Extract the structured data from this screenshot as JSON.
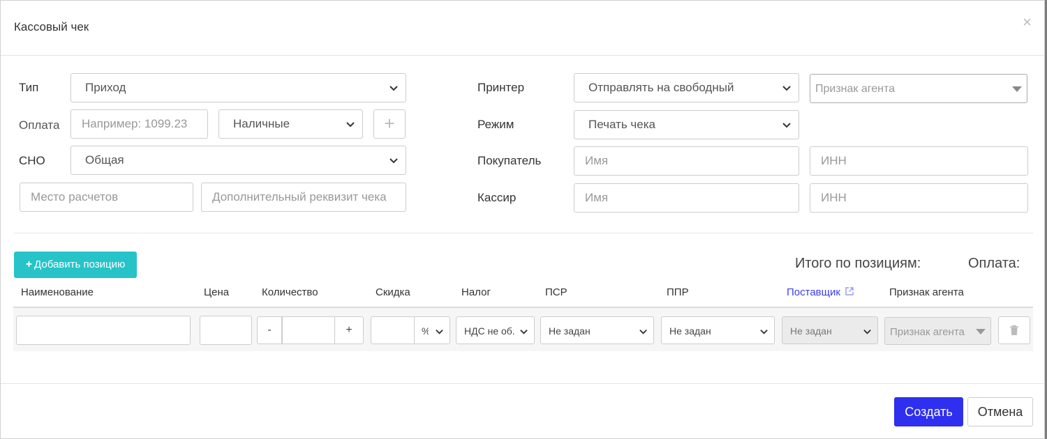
{
  "dialog": {
    "title": "Кассовый чек",
    "close_glyph": "×"
  },
  "form": {
    "type_label": "Тип",
    "type_value": "Приход",
    "payment_label": "Оплата",
    "payment_amount_placeholder": "Например: 1099.23",
    "payment_method_value": "Наличные",
    "payment_add_glyph": "+",
    "sno_label": "СНО",
    "sno_value": "Общая",
    "settlement_place_placeholder": "Место расчетов",
    "extra_requisite_placeholder": "Дополнительный реквизит чека",
    "printer_label": "Принтер",
    "printer_value": "Отправлять на свободный",
    "agent_placeholder": "Признак агента",
    "mode_label": "Режим",
    "mode_value": "Печать чека",
    "buyer_label": "Покупатель",
    "buyer_name_placeholder": "Имя",
    "buyer_inn_placeholder": "ИНН",
    "cashier_label": "Кассир",
    "cashier_name_placeholder": "Имя",
    "cashier_inn_placeholder": "ИНН"
  },
  "positions": {
    "add_button_icon": "+",
    "add_button_label": "Добавить позицию",
    "total_label": "Итого по позициям:",
    "payment_total_label": "Оплата:",
    "columns": [
      "Наименование",
      "Цена",
      "Количество",
      "Скидка",
      "Налог",
      "ПСР",
      "ППР",
      "Поставщик",
      "Признак агента"
    ],
    "row": {
      "minus_glyph": "-",
      "plus_glyph": "+",
      "discount_unit": "%",
      "tax_value": "НДС не об.",
      "psr_value": "Не задан",
      "ppr_value": "Не задан",
      "supplier_value": "Не задан",
      "agent_placeholder": "Признак агента"
    }
  },
  "footer": {
    "create_label": "Создать",
    "cancel_label": "Отмена"
  },
  "colors": {
    "primary": "#2f2ff0",
    "accent": "#26c3c8",
    "link": "#3c3cf0"
  }
}
